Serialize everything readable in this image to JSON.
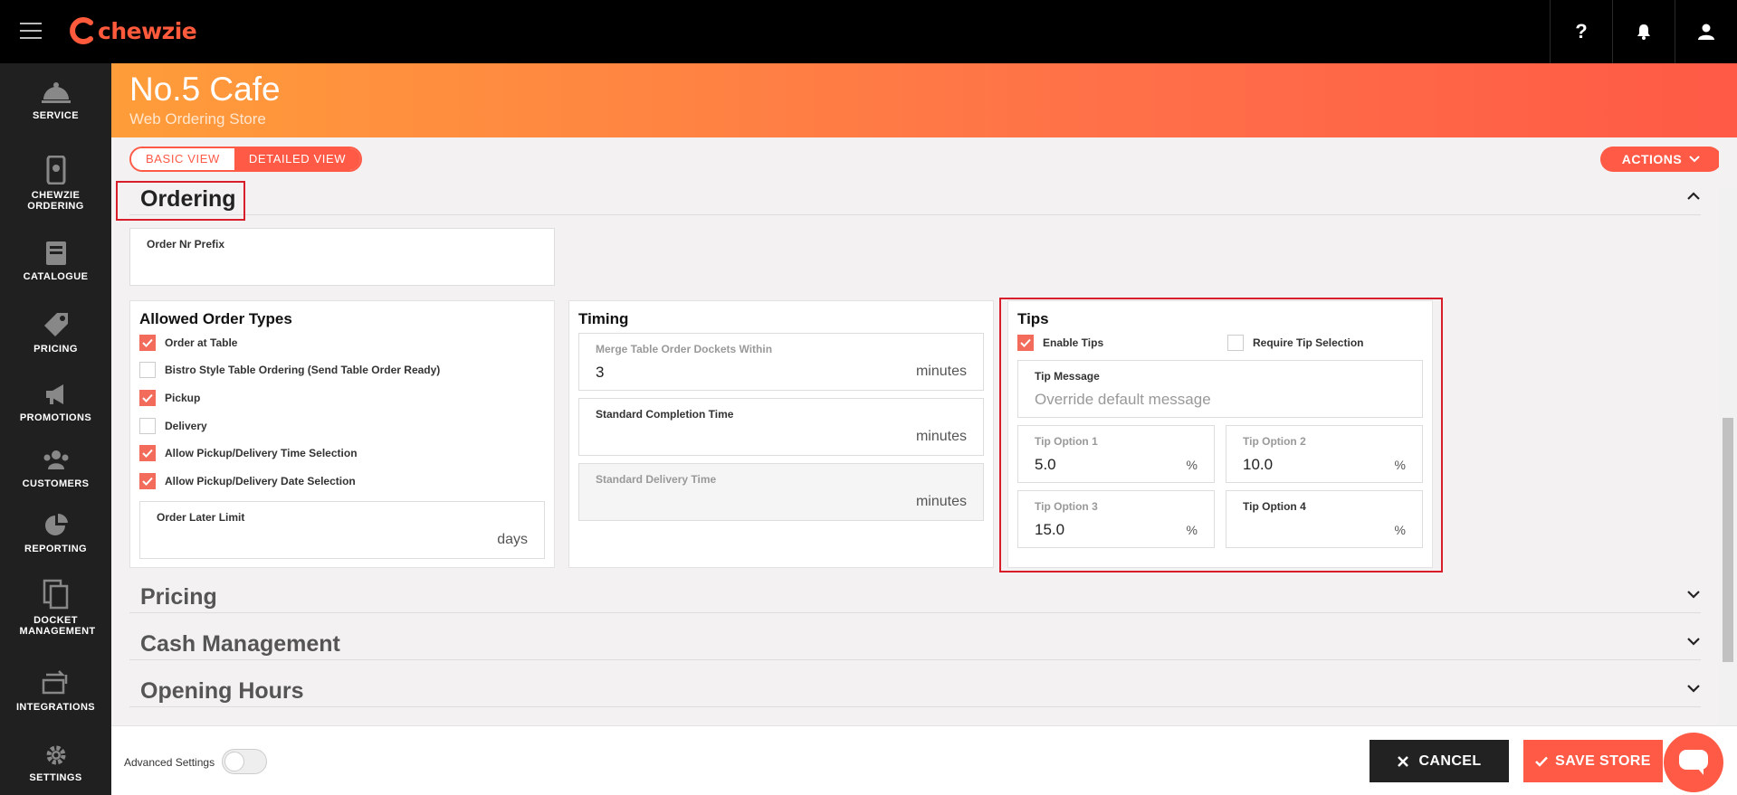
{
  "app": {
    "logo_text": "chewzie"
  },
  "topbar": {
    "help_label": "?"
  },
  "sidebar": {
    "items": [
      {
        "label": "SERVICE",
        "icon": "service-icon"
      },
      {
        "label": "CHEWZIE ORDERING",
        "icon": "ordering-icon"
      },
      {
        "label": "CATALOGUE",
        "icon": "catalogue-icon"
      },
      {
        "label": "PRICING",
        "icon": "pricing-icon"
      },
      {
        "label": "PROMOTIONS",
        "icon": "promotions-icon"
      },
      {
        "label": "CUSTOMERS",
        "icon": "customers-icon"
      },
      {
        "label": "REPORTING",
        "icon": "reporting-icon"
      },
      {
        "label": "DOCKET MANAGEMENT",
        "icon": "docket-icon"
      },
      {
        "label": "INTEGRATIONS",
        "icon": "integrations-icon"
      },
      {
        "label": "SETTINGS",
        "icon": "settings-icon"
      }
    ]
  },
  "header": {
    "store_name": "No.5 Cafe",
    "store_subtitle": "Web Ordering Store"
  },
  "toolbar": {
    "basic_view": "BASIC VIEW",
    "detailed_view": "DETAILED VIEW",
    "actions": "ACTIONS"
  },
  "ordering": {
    "title": "Ordering",
    "order_prefix": {
      "label": "Order Nr Prefix",
      "value": ""
    },
    "allowed_order_types": {
      "title": "Allowed Order Types",
      "items": [
        {
          "label": "Order at Table",
          "checked": true
        },
        {
          "label": "Bistro Style Table Ordering (Send Table Order Ready)",
          "checked": false
        },
        {
          "label": "Pickup",
          "checked": true
        },
        {
          "label": "Delivery",
          "checked": false
        },
        {
          "label": "Allow Pickup/Delivery Time Selection",
          "checked": true
        },
        {
          "label": "Allow Pickup/Delivery Date Selection",
          "checked": true
        }
      ],
      "order_later": {
        "label": "Order Later Limit",
        "value": "",
        "unit": "days"
      }
    },
    "timing": {
      "title": "Timing",
      "merge": {
        "label": "Merge Table Order Dockets Within",
        "value": "3",
        "unit": "minutes"
      },
      "completion": {
        "label": "Standard Completion Time",
        "value": "",
        "unit": "minutes"
      },
      "delivery": {
        "label": "Standard Delivery Time",
        "value": "",
        "unit": "minutes"
      }
    },
    "tips": {
      "title": "Tips",
      "enable_label": "Enable Tips",
      "enable_checked": true,
      "require_label": "Require Tip Selection",
      "require_checked": false,
      "message": {
        "label": "Tip Message",
        "placeholder": "Override default message"
      },
      "option1": {
        "label": "Tip Option 1",
        "value": "5.0",
        "unit": "%"
      },
      "option2": {
        "label": "Tip Option 2",
        "value": "10.0",
        "unit": "%"
      },
      "option3": {
        "label": "Tip Option 3",
        "value": "15.0",
        "unit": "%"
      },
      "option4": {
        "label": "Tip Option 4",
        "value": "",
        "unit": "%"
      }
    }
  },
  "sections": {
    "pricing": "Pricing",
    "cash": "Cash Management",
    "hours": "Opening Hours"
  },
  "footer": {
    "advanced_label": "Advanced Settings",
    "cancel": "CANCEL",
    "save": "SAVE STORE"
  },
  "colors": {
    "brand": "#ff5a46",
    "banner_start": "#ff9d3a",
    "dark": "#202020",
    "highlight": "#d81e2a"
  }
}
